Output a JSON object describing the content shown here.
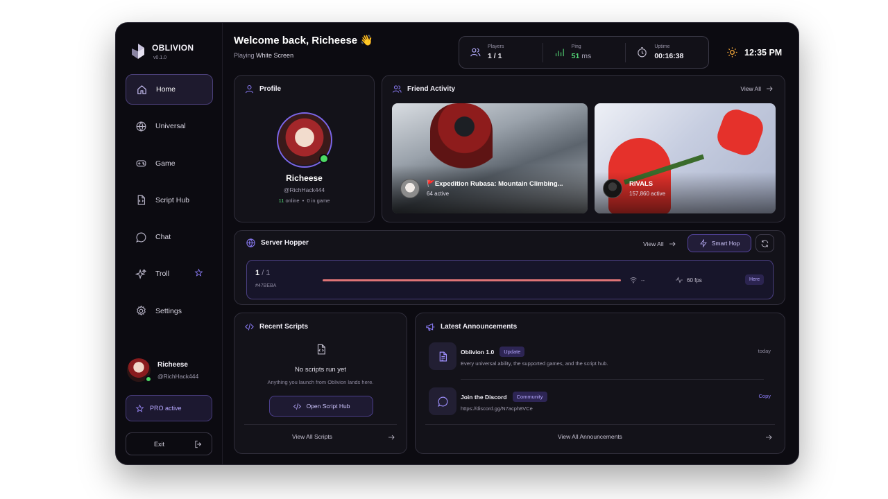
{
  "brand": {
    "name": "OBLIVION",
    "version": "v0.1.0"
  },
  "nav": [
    {
      "label": "Home",
      "icon": "home-icon",
      "active": true
    },
    {
      "label": "Universal",
      "icon": "globe-icon"
    },
    {
      "label": "Game",
      "icon": "gamepad-icon"
    },
    {
      "label": "Script Hub",
      "icon": "file-code-icon"
    },
    {
      "label": "Chat",
      "icon": "chat-icon"
    },
    {
      "label": "Troll",
      "icon": "sparkles-icon",
      "extra_icon": "star-icon"
    },
    {
      "label": "Settings",
      "icon": "gear-icon"
    }
  ],
  "user": {
    "name": "Richeese",
    "handle": "@RichHack444"
  },
  "pro_label": "PRO active",
  "exit_label": "Exit",
  "header": {
    "welcome": "Welcome back, Richeese 👋",
    "playing_prefix": "Playing",
    "playing_game": "White Screen"
  },
  "stats": {
    "players_label": "Players",
    "players_value": "1 / 1",
    "ping_label": "Ping",
    "ping_value": "51",
    "ping_unit": "ms",
    "uptime_label": "Uptime",
    "uptime_value": "00:16:38"
  },
  "clock": "12:35 PM",
  "profile": {
    "title": "Profile",
    "name": "Richeese",
    "handle": "@RichHack444",
    "online_count": "11",
    "online_label": "online",
    "separator": "•",
    "in_game": "0 in game"
  },
  "friends": {
    "title": "Friend Activity",
    "view_all": "View All",
    "games": [
      {
        "name": "🚩Expedition Rubasa: Mountain Climbing...",
        "active": "64 active"
      },
      {
        "name": "RIVALS",
        "active": "157,860 active"
      }
    ]
  },
  "server": {
    "title": "Server Hopper",
    "view_all": "View All",
    "smart_hop": "Smart Hop",
    "count_current": "1",
    "count_total": "/ 1",
    "id": "#47BEBA",
    "wifi": "--",
    "fps": "60 fps",
    "here": "Here"
  },
  "scripts": {
    "title": "Recent Scripts",
    "empty_title": "No scripts run yet",
    "empty_sub": "Anything you launch from Oblivion lands here.",
    "open_hub": "Open Script Hub",
    "view_all": "View All Scripts"
  },
  "announcements": {
    "title": "Latest Announcements",
    "items": [
      {
        "title": "Oblivion 1.0",
        "tag": "Update",
        "desc": "Every universal ability, the supported games, and the script hub.",
        "meta": "today"
      },
      {
        "title": "Join the Discord",
        "tag": "Community",
        "desc": "https://discord.gg/N7acph8VCe",
        "meta": "Copy"
      }
    ],
    "view_all": "View All Announcements"
  },
  "colors": {
    "accent": "#8f7fff",
    "online": "#4cd964",
    "ping": "#52d274",
    "server_bar": "#e07476",
    "background": "#0c0b11"
  }
}
